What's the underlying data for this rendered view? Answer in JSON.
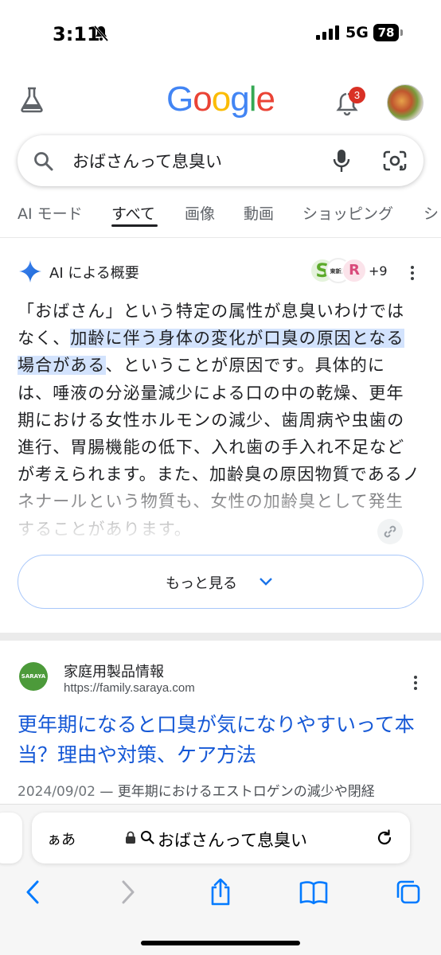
{
  "status_bar": {
    "time": "3:11",
    "network": "5G",
    "battery": "78"
  },
  "header": {
    "logo_letters": [
      {
        "ch": "G",
        "color": "#4285F4"
      },
      {
        "ch": "o",
        "color": "#EA4335"
      },
      {
        "ch": "o",
        "color": "#FBBC05"
      },
      {
        "ch": "g",
        "color": "#4285F4"
      },
      {
        "ch": "l",
        "color": "#34A853"
      },
      {
        "ch": "e",
        "color": "#EA4335"
      }
    ],
    "notification_count": "3"
  },
  "search": {
    "query": "おばさんって息臭い"
  },
  "tabs": [
    "AI モード",
    "すべて",
    "画像",
    "動画",
    "ショッピング",
    "シ"
  ],
  "active_tab": "すべて",
  "ai_overview": {
    "title": "AI による概要",
    "source_more": "+9",
    "text_before": "「おばさん」という特定の属性が息臭いわけではなく、",
    "text_highlight": "加齢に伴う身体の変化が口臭の原因となる場合がある",
    "text_after": "、ということが原因です。具体的には、唾液の分泌量減少による口の中の乾燥、更年期における女性ホルモンの減少、歯周病や虫歯の進行、胃腸機能の低下、入れ歯の手入れ不足などが考えられます。また、加齢臭の原因物質であるノネナールという物質も、女性の加齢臭として発生することがあります。",
    "more_button": "もっと見る"
  },
  "result": {
    "site_name": "家庭用製品情報",
    "url": "https://family.saraya.com",
    "title": "更年期になると口臭が気になりやすいって本当？理由や対策、ケア方法",
    "date": "2024/09/02",
    "snippet": " — 更年期におけるエストロゲンの減少や閉経",
    "logo_text": "SARAYA"
  },
  "safari": {
    "aa": "ぁあ",
    "url_text": "おばさんって息臭い"
  },
  "colors": {
    "accent": "#1558d6",
    "highlight": "#d3e3fd",
    "badge": "#d93025"
  }
}
